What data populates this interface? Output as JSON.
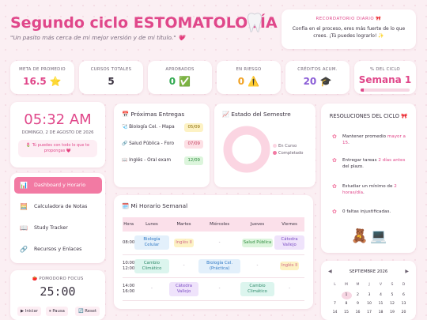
{
  "header": {
    "title": "Segundo ciclo ESTOMATOLOGÍA",
    "subtitle": "\"Un pasito más cerca de mi mejor versión y de mi título.\" 💗"
  },
  "quote": {
    "label": "RECORDATORIO DIARIO 🎀",
    "text": "Confía en el proceso, eres más fuerte de lo que crees. ¡Tú puedes lograrlo! ✨"
  },
  "stats": [
    {
      "label": "META DE PROMEDIO",
      "value": "16.5 ⭐",
      "color": "#e0478a"
    },
    {
      "label": "CURSOS TOTALES",
      "value": "5",
      "color": "#3a3240"
    },
    {
      "label": "APROBADOS",
      "value": "0 ✅",
      "color": "#2fa84f"
    },
    {
      "label": "EN RIESGO",
      "value": "0 ⚠️",
      "color": "#f0a020"
    },
    {
      "label": "CRÉDITOS ACUM.",
      "value": "20 🎓",
      "color": "#8a5cd6"
    },
    {
      "label": "% DEL CICLO",
      "value": "Semana 1",
      "color": "#e0478a",
      "progress": 0.06
    }
  ],
  "clock": {
    "time": "05:32 AM",
    "date": "DOMINGO, 2 DE AGOSTO DE 2026",
    "message": "🌷 Tú puedes con todo lo que te propongas 💗"
  },
  "nav": [
    {
      "icon": "📊",
      "label": "Dashboard y Horario"
    },
    {
      "icon": "🧮",
      "label": "Calculadora de Notas"
    },
    {
      "icon": "📖",
      "label": "Study Tracker"
    },
    {
      "icon": "🔗",
      "label": "Recursos y Enlaces"
    }
  ],
  "pomodoro": {
    "title": "🍅 POMODORO FOCUS",
    "time": "25:00",
    "start": "▶ Iniciar",
    "pause": "⏸ Pausa",
    "reset": "🔄 Reset"
  },
  "deliveries": {
    "title": "📅 Próximas Entregas",
    "items": [
      {
        "icon": "🩺",
        "name": "Biología Cel. - Mapa",
        "date": "05/09",
        "bg": "#fdf2c4",
        "fg": "#8a6a00"
      },
      {
        "icon": "🔗",
        "name": "Salud Pública - Foro",
        "date": "07/09",
        "bg": "#fde0e5",
        "fg": "#c0395a"
      },
      {
        "icon": "📖",
        "name": "Inglés - Oral exam",
        "date": "12/09",
        "bg": "#dcf5dc",
        "fg": "#2f8a3f"
      }
    ]
  },
  "semester": {
    "title": "📈 Estado del Semestre",
    "legend": [
      "En Curso",
      "Completado"
    ],
    "chart_data": {
      "type": "pie",
      "labels": [
        "En Curso",
        "Completado"
      ],
      "values": [
        100,
        0
      ],
      "colors": [
        "#fbd5e2",
        "#f27aa3"
      ]
    }
  },
  "schedule": {
    "title": "🗓️ Mi Horario Semanal",
    "columns": [
      "Hora",
      "Lunes",
      "Martes",
      "Miércoles",
      "Jueves",
      "Viernes"
    ],
    "rows": [
      {
        "hour": "08:00",
        "cells": [
          "Biología Celular",
          "Inglés II",
          "-",
          "Salud Pública",
          "Cátedra Vallejo"
        ]
      },
      {
        "hour": "10:00\n12:00",
        "cells": [
          "Cambio Climático",
          "-",
          "Biología Cel. (Práctica)",
          "-",
          "Inglés II"
        ]
      },
      {
        "hour": "14:00\n16:00",
        "cells": [
          "-",
          "Cátedra Vallejo",
          "-",
          "Cambio Climático",
          "-"
        ]
      }
    ]
  },
  "resolutions": {
    "title": "RESOLUCIONES DEL CICLO 🎀",
    "items": [
      {
        "pre": "Mantener promedio ",
        "hl": "mayor a 15",
        "post": "."
      },
      {
        "pre": "Entregar tareas ",
        "hl": "2 días antes",
        "post": " del plazo."
      },
      {
        "pre": "Estudiar un mínimo de ",
        "hl": "2 horas/día",
        "post": "."
      },
      {
        "pre": "0 faltas injustificadas.",
        "hl": "",
        "post": ""
      }
    ]
  },
  "calendar": {
    "month": "SEPTIEMBRE 2026",
    "weekdays": [
      "L",
      "M",
      "M",
      "J",
      "V",
      "S",
      "D"
    ],
    "days": [
      "",
      "1",
      "2",
      "3",
      "4",
      "5",
      "6",
      "7",
      "8",
      "9",
      "10",
      "11",
      "12",
      "13",
      "14",
      "15",
      "16",
      "17",
      "18",
      "19",
      "20"
    ],
    "today": "1"
  }
}
